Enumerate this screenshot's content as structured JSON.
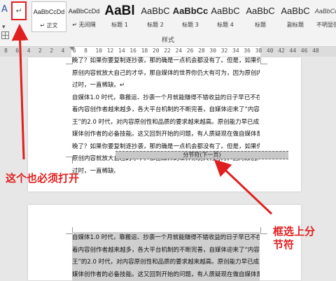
{
  "ribbon": {
    "left_tools": {
      "icon_a": "A",
      "icon_a_sub": "▾",
      "pilcrow": "↵"
    },
    "styles": [
      {
        "sample": "AaBbCcDd",
        "label": "↵ 正文",
        "kind": "small",
        "selected": true
      },
      {
        "sample": "AaBbCcDd",
        "label": "↵ 无间隔",
        "kind": "small"
      },
      {
        "sample": "AaBl",
        "label": "标题 1",
        "kind": "h1"
      },
      {
        "sample": "AaBbC",
        "label": "标题 2",
        "kind": "h"
      },
      {
        "sample": "AaBbCc",
        "label": "标题 3",
        "kind": "hb"
      },
      {
        "sample": "AaBbC",
        "label": "标题 4",
        "kind": "h"
      },
      {
        "sample": "AaBbC",
        "label": "标题",
        "kind": "h"
      },
      {
        "sample": "AaBbC",
        "label": "副标题",
        "kind": "h"
      },
      {
        "sample": "AaBbCcDd",
        "label": "不明显强调",
        "kind": "it"
      }
    ],
    "group_label": "样式"
  },
  "ruler": {
    "numbers": [
      "8",
      "6",
      "4",
      "2",
      "2",
      "4",
      "6",
      "8",
      "10",
      "12",
      "14",
      "16",
      "18",
      "20",
      "22",
      "24",
      "26",
      "28",
      "30",
      "32",
      "34",
      "36",
      "38",
      "40",
      "42",
      "44",
      "46",
      "48"
    ]
  },
  "page1": {
    "lines": [
      "晚了？如果你要复制逐抄袭，那的确是一点机会都没有了。但是，如果你要复",
      "原创内容就放大自己的才华，那自媒体的世界你仍大有可为，因为原创内容永不",
      "过时，一直稀缺。↵",
      "自媒体1.0 时代，靠搬运、抄袭一个月就能赚得不错收益的日子早已不在。随",
      "着内容创作者越来越多，各大平台机制的不断完善，自媒体迎来了“内容为",
      "王”的2.0 时代，对内容原创性和品质的要求越来越高。原创能力早已成为自",
      "媒体创作者的必备技能。这又回到开始的问题，有人质疑现在做自媒体是不是",
      "晚了？如果你要复制逐抄袭，那的确是一点机会都没有了。但是，如果你要复",
      "原创内容就放大自己的才华，那自媒体的世界你仍大有可为，因为原创内容永不",
      "过时，一直稀缺。"
    ],
    "section_break": "分节符(下一页)"
  },
  "page2": {
    "lines": [
      "自媒体1.0 时代，靠搬运、抄袭一个月就能赚得不错收益的日子早已不在。随",
      "着内容创作者越来越多，各大平台机制的不断完善，自媒体迎来了“内容为",
      "王”的2.0 时代，对内容原创性和品质的要求越来越高。原创能力早已成为自",
      "媒体创作者的必备技能。这又回到开始的问题，有人质疑现在做自媒体是不是"
    ]
  },
  "annotations": {
    "left_note": "这个也必须打开",
    "right_note_line1": "框选上分",
    "right_note_line2": "节符",
    "color": "#e02020"
  }
}
